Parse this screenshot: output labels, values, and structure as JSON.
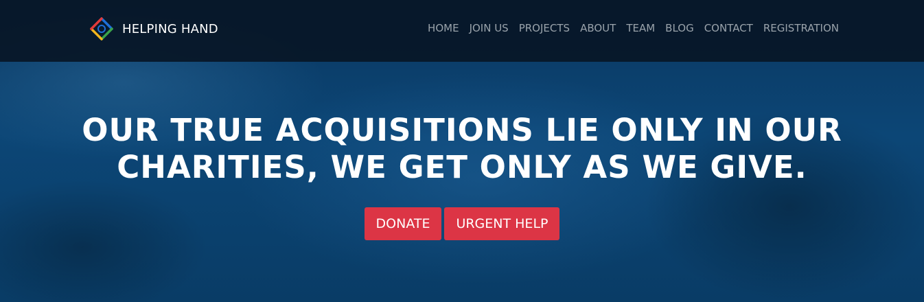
{
  "brand": {
    "name": "HELPING HAND",
    "logo_icon": "helping-hand-logo-icon",
    "logo_colors": [
      "#1e6fd9",
      "#e23a3a",
      "#f2b51d",
      "#3aa34a"
    ]
  },
  "nav": {
    "items": [
      {
        "label": "HOME"
      },
      {
        "label": "JOIN US"
      },
      {
        "label": "PROJECTS"
      },
      {
        "label": "ABOUT"
      },
      {
        "label": "TEAM"
      },
      {
        "label": "BLOG"
      },
      {
        "label": "CONTACT"
      },
      {
        "label": "REGISTRATION"
      }
    ]
  },
  "hero": {
    "headline_line1": "OUR TRUE ACQUISITIONS LIE ONLY IN OUR",
    "headline_line2": "CHARITIES, WE GET ONLY AS WE GIVE.",
    "donate_label": "DONATE",
    "urgent_help_label": "URGENT HELP"
  },
  "colors": {
    "accent": "#dc3545",
    "navbar_bg": "#081626",
    "hero_bg": "#0c4676",
    "nav_text": "#9aa3ab"
  }
}
